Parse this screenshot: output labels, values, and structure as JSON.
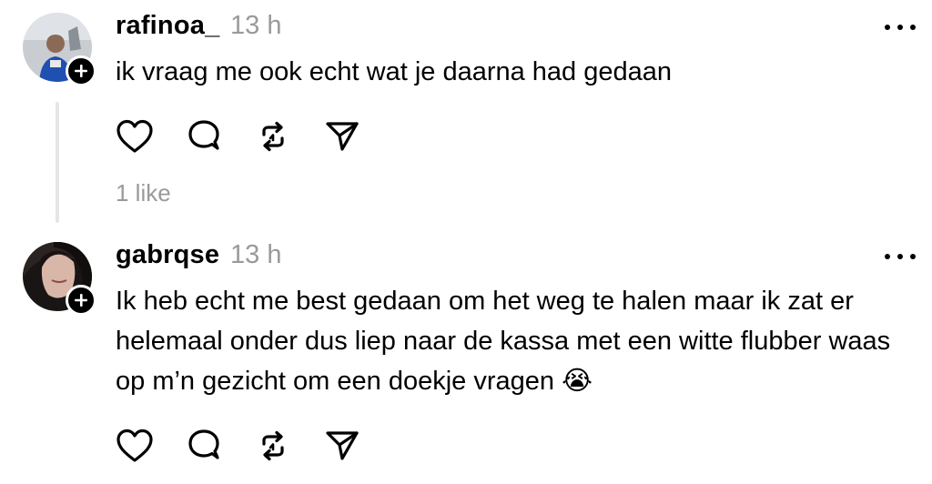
{
  "comments": [
    {
      "username": "rafinoa_",
      "time": "13 h",
      "text": "ik vraag me ook echt wat je daarna had gedaan",
      "likes": "1 like",
      "avatar_icon": "user-photo-avatar",
      "follow_icon": "plus-icon"
    },
    {
      "username": "gabrqse",
      "time": "13 h",
      "text": "Ik heb echt me best gedaan om het weg te halen maar ik zat er helemaal onder dus liep naar de kassa met een witte flubber waas op m’n gezicht om een doekje vragen 😭",
      "avatar_icon": "user-photo-avatar",
      "follow_icon": "plus-icon"
    }
  ],
  "icons": {
    "like": "heart-icon",
    "reply": "comment-bubble-icon",
    "repost": "repost-icon",
    "share": "send-icon",
    "more": "more-dots-icon"
  }
}
